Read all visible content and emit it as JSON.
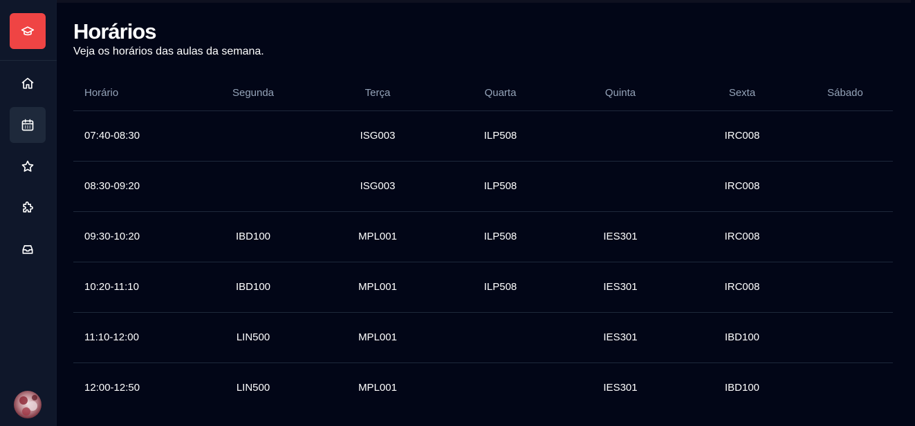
{
  "page": {
    "title": "Horários",
    "subtitle": "Veja os horários das aulas da semana."
  },
  "sidebar": {
    "logo_icon": "graduation-cap-icon",
    "items": [
      {
        "icon": "home-icon",
        "active": false
      },
      {
        "icon": "calendar-icon",
        "active": true
      },
      {
        "icon": "star-icon",
        "active": false
      },
      {
        "icon": "puzzle-icon",
        "active": false
      },
      {
        "icon": "inbox-icon",
        "active": false
      }
    ],
    "avatar_icon": "user-avatar"
  },
  "schedule": {
    "headers": [
      "Horário",
      "Segunda",
      "Terça",
      "Quarta",
      "Quinta",
      "Sexta",
      "Sábado"
    ],
    "rows": [
      [
        "07:40-08:30",
        "",
        "ISG003",
        "ILP508",
        "",
        "IRC008",
        ""
      ],
      [
        "08:30-09:20",
        "",
        "ISG003",
        "ILP508",
        "",
        "IRC008",
        ""
      ],
      [
        "09:30-10:20",
        "IBD100",
        "MPL001",
        "ILP508",
        "IES301",
        "IRC008",
        ""
      ],
      [
        "10:20-11:10",
        "IBD100",
        "MPL001",
        "ILP508",
        "IES301",
        "IRC008",
        ""
      ],
      [
        "11:10-12:00",
        "LIN500",
        "MPL001",
        "",
        "IES301",
        "IBD100",
        ""
      ],
      [
        "12:00-12:50",
        "LIN500",
        "MPL001",
        "",
        "IES301",
        "IBD100",
        ""
      ]
    ]
  },
  "colors": {
    "background": "#020617",
    "sidebar": "#0f172a",
    "accent": "#ef4444",
    "header_text": "#94a3b8",
    "divider": "#1e293b"
  }
}
